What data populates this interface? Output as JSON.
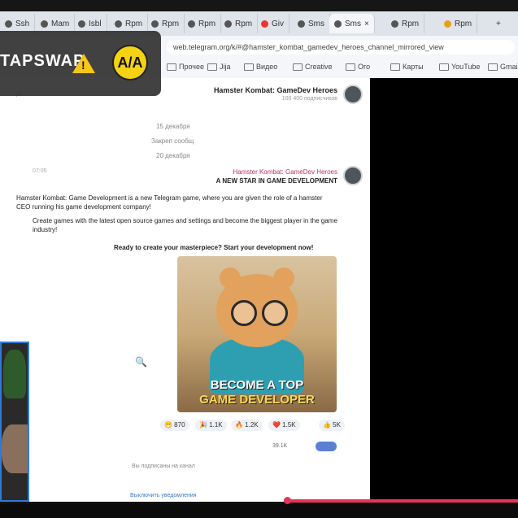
{
  "browser": {
    "tabs": [
      {
        "label": "Ssh"
      },
      {
        "label": "Mam"
      },
      {
        "label": "Isbl"
      },
      {
        "label": "Rpm"
      },
      {
        "label": "Rpm"
      },
      {
        "label": "Rpm"
      },
      {
        "label": "Rpm"
      },
      {
        "label": "Giv"
      },
      {
        "label": "Sms"
      },
      {
        "label": "Sms"
      },
      {
        "label": "Rpm"
      },
      {
        "label": "Rpm"
      }
    ],
    "url": "web.telegram.org/k/#@hamster_kombat_gamedev_heroes_channel_mirrored_view",
    "bookmarks": [
      "Gmail",
      "YouTube",
      "Карты",
      "Ого",
      "Creative",
      "Видео",
      "Jija",
      "Прочее"
    ]
  },
  "overlay": {
    "text": "TAPSWAP",
    "logo": "A/A"
  },
  "channel": {
    "title": "Hamster Kombat: GameDev Heroes",
    "subtitle": "100 400 подписчиков"
  },
  "system_lines": [
    "15 декабря",
    "Закреп сообщ",
    "20 декабря"
  ],
  "message": {
    "name": "Hamster Kombat: GameDev Heroes",
    "time": "07:05",
    "headline": "A NEW STAR IN GAME DEVELOPMENT",
    "para1": "Hamster Kombat: Game Development is a new Telegram game, where you are given the role of a hamster CEO running his game development company!",
    "para2": "Create games with the latest open source games and settings and become the biggest player in the game industry!",
    "para3": "Ready to create your masterpiece? Start your development now!",
    "image_caption_top": "BECOME A TOP",
    "image_caption_bottom": "GAME DEVELOPER",
    "reactions": [
      "👍 5K",
      "❤️ 1.5K",
      "🔥 1.2K",
      "🎉 1.1K",
      "😁 870"
    ],
    "views": "39.1K"
  },
  "footer": {
    "line1": "Вы подписаны на канал",
    "line2": "Выключить уведомления"
  }
}
